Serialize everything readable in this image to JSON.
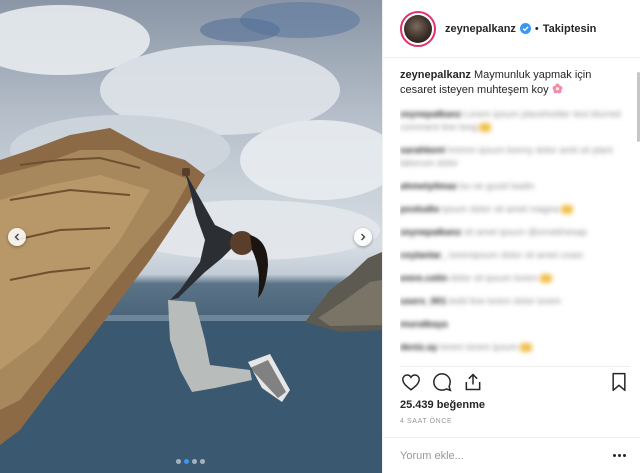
{
  "post": {
    "username": "zeynepalkanz",
    "follow_status": "Takiptesin",
    "separator": "•",
    "caption_user": "zeynepalkanz",
    "caption_text": "Maymunluk yapmak için cesaret isteyen muhteşem koy",
    "caption_emoji": "flower-icon",
    "likes": "25.439 beğenme",
    "time_ago": "4 SAAT ÖNCE",
    "comment_placeholder": "Yorum ekle..."
  },
  "carousel": {
    "slide_count": 4,
    "active_index": 1
  },
  "blurred_comments": [
    {
      "user": "zeynepalkanz",
      "text": "Lorem ipsum placeholder text blurred comment line long"
    },
    {
      "user": "sarahkent",
      "text": "hmmm ipsum bonny dolor amit sit plant laborum dolor"
    },
    {
      "user": "ahmetyilmaz",
      "text": "bu ne guzel kadin"
    },
    {
      "user": "pxstudio",
      "text": "ipsum dolor sit amet magna"
    },
    {
      "user": "zeynepalkanz",
      "text": "sit amet ipsum @ornekhesap"
    },
    {
      "user": "ceylanlar_",
      "text": "loremipsum dolor sit amet coasi"
    },
    {
      "user": "emre.cetin",
      "text": "dolor sit ipsum lorem"
    },
    {
      "user": "userx_001",
      "text": "bold line lorem dolor lorem"
    },
    {
      "user": "muratkaya",
      "text": ""
    },
    {
      "user": "deniz.ay",
      "text": "lorem lorem ipsum"
    }
  ],
  "colors": {
    "accent": "#3897f0",
    "verified": "#3897f0",
    "ring": "#e1306c"
  }
}
